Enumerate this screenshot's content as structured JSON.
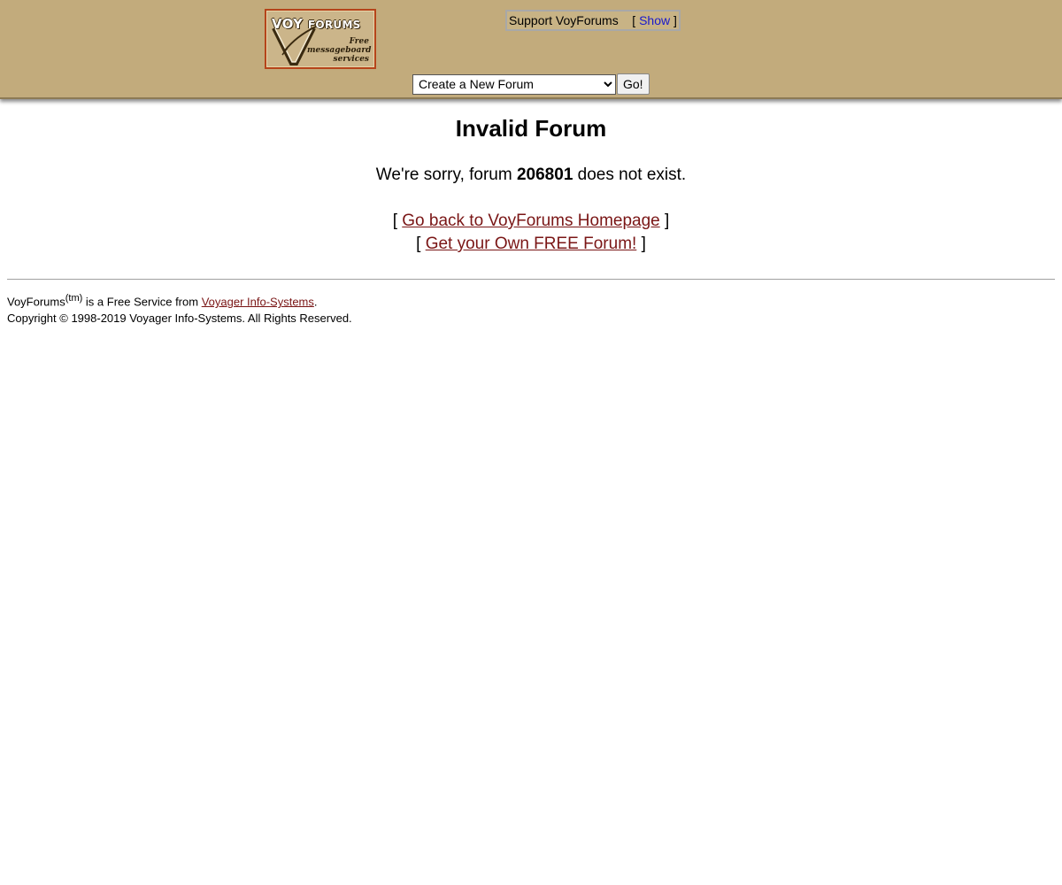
{
  "header": {
    "logo": {
      "title_main": "VOY",
      "title_rest": "FORUMS",
      "subtitle_lines": [
        "Free",
        "messageboard",
        "services"
      ]
    },
    "support": {
      "label": "Support VoyForums",
      "bracket_open": "[",
      "show_label": "Show",
      "bracket_close": "]"
    },
    "forum_select": {
      "selected": "Create a New Forum"
    },
    "go_label": "Go!"
  },
  "main": {
    "title": "Invalid Forum",
    "message_prefix": "We're sorry, forum",
    "forum_id": "206801",
    "message_suffix": "does not exist.",
    "links": [
      {
        "open": "[",
        "label": "Go back to VoyForums Homepage",
        "close": "]"
      },
      {
        "open": "[",
        "label": "Get your Own FREE Forum!",
        "close": "]"
      }
    ]
  },
  "footer": {
    "brand": "VoyForums",
    "tm": "(tm)",
    "service_text": "is a Free Service from",
    "company_link": "Voyager Info-Systems",
    "period": ".",
    "copyright": "Copyright © 1998-2019 Voyager Info-Systems. All Rights Reserved."
  },
  "colors": {
    "header_bg": "#c2ab7c",
    "link": "#7a1616",
    "show_link": "#1a1acc",
    "logo_border": "#b5441a"
  }
}
